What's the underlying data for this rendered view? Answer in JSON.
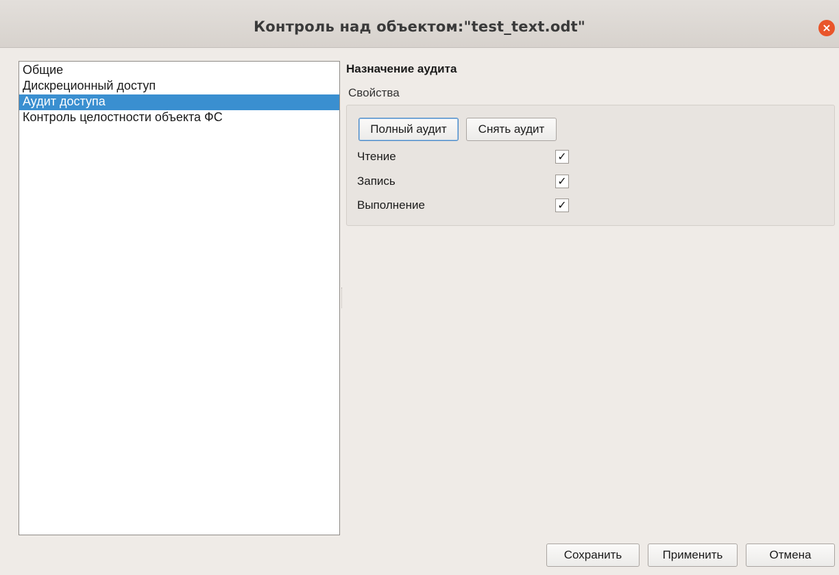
{
  "window": {
    "title": "Контроль над объектом:\"test_text.odt\"",
    "close_icon": "×"
  },
  "nav": {
    "items": [
      {
        "label": "Общие",
        "selected": false
      },
      {
        "label": "Дискреционный доступ",
        "selected": false
      },
      {
        "label": "Аудит доступа",
        "selected": true
      },
      {
        "label": "Контроль целостности объекта ФС",
        "selected": false
      }
    ]
  },
  "audit": {
    "section_title": "Назначение аудита",
    "group_label": "Свойства",
    "full_audit_label": "Полный аудит",
    "remove_audit_label": "Снять аудит",
    "properties": [
      {
        "label": "Чтение",
        "checked": true,
        "mark": "✓"
      },
      {
        "label": "Запись",
        "checked": true,
        "mark": "✓"
      },
      {
        "label": "Выполнение",
        "checked": true,
        "mark": "✓"
      }
    ]
  },
  "footer": {
    "save_label": "Сохранить",
    "apply_label": "Применить",
    "cancel_label": "Отмена"
  },
  "colors": {
    "selection": "#3a8fd0",
    "close_button": "#e9552a"
  }
}
